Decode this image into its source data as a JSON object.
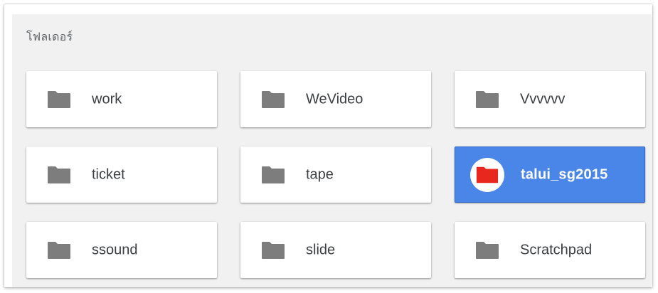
{
  "section": {
    "title": "โฟลเดอร์"
  },
  "colors": {
    "folder_icon": "#7d7d7d",
    "selected_background": "#4a86e8",
    "selected_icon": "#e8271f"
  },
  "folders": [
    {
      "label": "work",
      "icon": "folder-icon",
      "selected": false
    },
    {
      "label": "WeVideo",
      "icon": "folder-icon",
      "selected": false
    },
    {
      "label": "Vvvvvv",
      "icon": "folder-icon",
      "selected": false
    },
    {
      "label": "ticket",
      "icon": "folder-icon",
      "selected": false
    },
    {
      "label": "tape",
      "icon": "folder-icon",
      "selected": false
    },
    {
      "label": "talui_sg2015",
      "icon": "folder-icon",
      "selected": true
    },
    {
      "label": "ssound",
      "icon": "folder-icon",
      "selected": false
    },
    {
      "label": "slide",
      "icon": "folder-icon",
      "selected": false
    },
    {
      "label": "Scratchpad",
      "icon": "folder-icon",
      "selected": false
    }
  ]
}
